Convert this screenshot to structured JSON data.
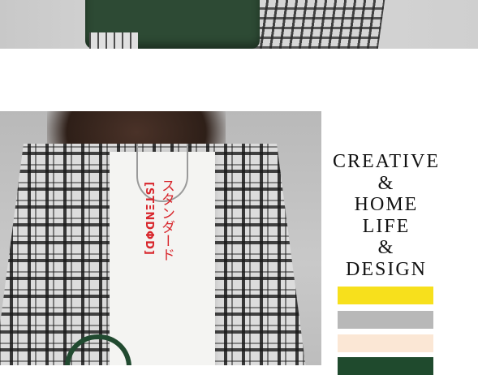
{
  "tagline": {
    "line1": "CREATIVE",
    "line2": "&",
    "line3": "HOME",
    "line4": "LIFE",
    "line5": "&",
    "line6": "DESIGN"
  },
  "tshirt_print": {
    "japanese": "スタンダード",
    "latin": "[STΞNDΦD]"
  },
  "swatches": [
    {
      "name": "yellow",
      "color": "#f7e01c"
    },
    {
      "name": "gray",
      "color": "#b8b8b8"
    },
    {
      "name": "cream",
      "color": "#fbe7d5"
    },
    {
      "name": "dark-green",
      "color": "#1f4a2d"
    }
  ]
}
